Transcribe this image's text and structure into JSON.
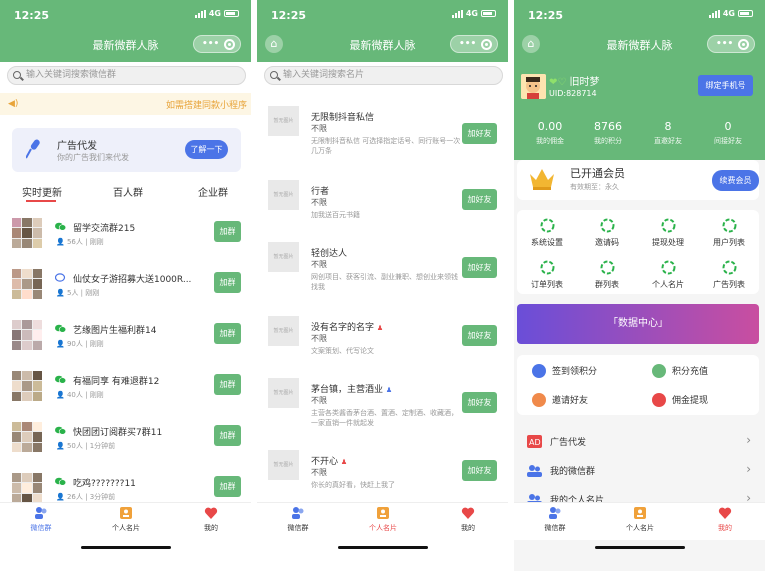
{
  "status": {
    "time": "12:25",
    "network": "4G"
  },
  "app_title": "最新微群人脉",
  "colors": {
    "brand_green": "#67b879",
    "accent_blue": "#4b74e7",
    "notice_orange": "#e8a43a",
    "tab_red": "#e84848"
  },
  "tabbar": {
    "items": [
      {
        "label": "微信群",
        "icon": "wechat-group-icon"
      },
      {
        "label": "个人名片",
        "icon": "card-icon"
      },
      {
        "label": "我的",
        "icon": "heart-icon"
      }
    ]
  },
  "screen1": {
    "search_placeholder": "输入关键词搜索微信群",
    "notice": "如需搭建同款小程序",
    "ad": {
      "title": "广告代发",
      "subtitle": "你的广告我们来代发",
      "button": "了解一下"
    },
    "tabs": [
      "实时更新",
      "百人群",
      "企业群"
    ],
    "groups": [
      {
        "name": "留学交流群215",
        "count": "56人",
        "time": "刚刚",
        "join": "加群"
      },
      {
        "name": "仙仗女子游招募大送1000R...",
        "count": "5人",
        "time": "刚刚",
        "join": "加群"
      },
      {
        "name": "艺缘图片生福利群14",
        "count": "90人",
        "time": "刚刚",
        "join": "加群"
      },
      {
        "name": "有福同享 有难退群12",
        "count": "40人",
        "time": "刚刚",
        "join": "加群"
      },
      {
        "name": "快团团订阅群买7群11",
        "count": "50人",
        "time": "1分钟前",
        "join": "加群"
      },
      {
        "name": "吃鸡???????11",
        "count": "26人",
        "time": "3分钟前",
        "join": "加群"
      }
    ]
  },
  "screen2": {
    "search_placeholder": "输入关键词搜索名片",
    "cards": [
      {
        "title": "无限制抖音私信",
        "sub": "不限",
        "desc": "无限制抖音私信 可选择指定话号、同行账号一次几万条",
        "btn": "加好友"
      },
      {
        "title": "行者",
        "sub": "不限",
        "desc": "加我送百元书籍",
        "btn": "加好友"
      },
      {
        "title": "轻创达人",
        "sub": "不限",
        "desc": "网创项目、获客引流、副业兼职、想创业来领钱找我",
        "btn": "加好友"
      },
      {
        "title": "没有名字的名字",
        "sub": "不限",
        "desc": "文案策划、代写论文",
        "btn": "加好友"
      },
      {
        "title": "茅台镇，主营酒业",
        "sub": "不限",
        "desc": "主营各类酱香茅台酒、置酒、定制酒、收藏酒，一家直销一件就起发",
        "btn": "加好友"
      },
      {
        "title": "不开心",
        "sub": "不限",
        "desc": "你长的真好看，快赶上我了",
        "btn": "加好友"
      }
    ],
    "thumb_text": "暂无图片"
  },
  "screen3": {
    "user": {
      "name": "旧时梦",
      "uid": "UID:828714",
      "bind": "绑定手机号"
    },
    "stats": [
      {
        "value": "0.00",
        "label": "我的佣金"
      },
      {
        "value": "8766",
        "label": "我的积分"
      },
      {
        "value": "8",
        "label": "直邀好友"
      },
      {
        "value": "0",
        "label": "间接好友"
      }
    ],
    "member": {
      "title": "已开通会员",
      "sub": "有效期至：永久",
      "button": "续费会员"
    },
    "menu": [
      "系统设置",
      "邀请码",
      "提现处理",
      "用户列表",
      "订单列表",
      "群列表",
      "个人名片",
      "广告列表"
    ],
    "data_center": "「数据中心」",
    "actions": [
      {
        "label": "签到领积分",
        "color": "#4b74e7"
      },
      {
        "label": "积分充值",
        "color": "#67b879"
      },
      {
        "label": "邀请好友",
        "color": "#f08a4b"
      },
      {
        "label": "佣金提现",
        "color": "#e84848"
      }
    ],
    "list": [
      {
        "label": "广告代发",
        "icon": "ad-icon"
      },
      {
        "label": "我的微信群",
        "icon": "people-icon"
      },
      {
        "label": "我的个人名片",
        "icon": "people-icon"
      }
    ]
  }
}
